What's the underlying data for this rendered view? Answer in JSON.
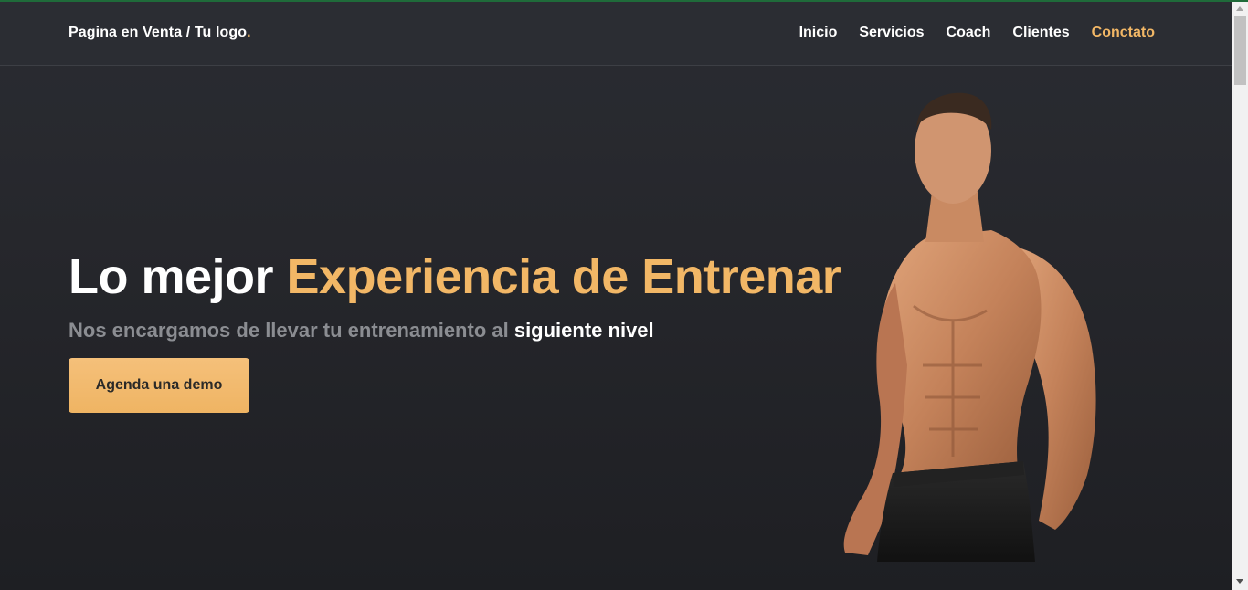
{
  "header": {
    "logo_text": "Pagina en Venta / Tu logo",
    "logo_dot": "."
  },
  "nav": {
    "items": [
      "Inicio",
      "Servicios",
      "Coach",
      "Clientes",
      "Conctato"
    ]
  },
  "hero": {
    "title_plain": "Lo mejor ",
    "title_accent": "Experiencia de Entrenar",
    "subtitle_plain": "Nos encargamos de llevar tu entrenamiento al ",
    "subtitle_strong": "siguiente nivel",
    "cta_label": "Agenda una demo"
  },
  "colors": {
    "accent": "#f2b766",
    "background": "#26282d",
    "text": "#ffffff",
    "muted_text": "#8b8d92"
  }
}
